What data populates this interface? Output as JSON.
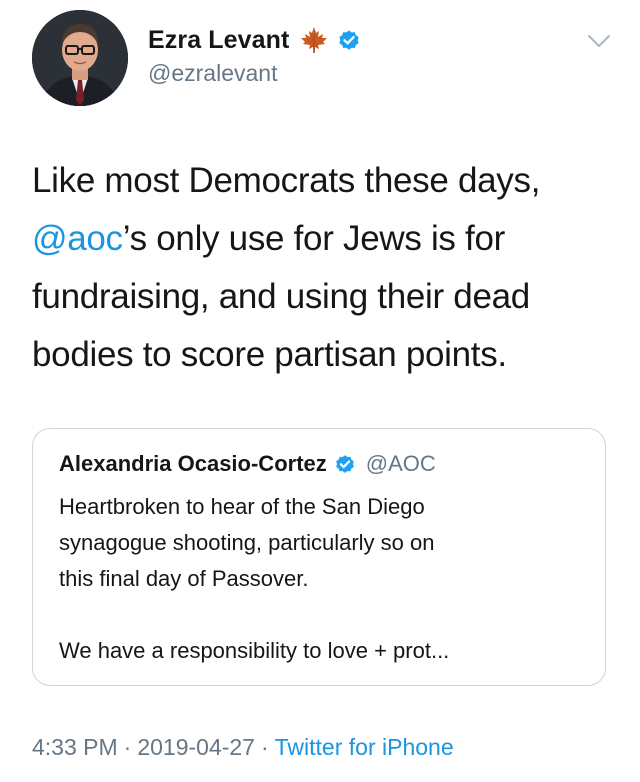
{
  "author": {
    "display_name": "Ezra Levant",
    "handle": "@ezralevant",
    "badge_icons": [
      "maple-leaf-icon",
      "verified-badge-icon"
    ],
    "menu_icon": "chevron-down-icon"
  },
  "tweet": {
    "line1": "Like most Democrats these days,",
    "mention": "@aoc",
    "line2_rest": "’s only use for Jews is for",
    "line3": "fundraising, and using their dead",
    "line4": "bodies to score partisan points."
  },
  "quote": {
    "display_name": "Alexandria Ocasio-Cortez",
    "handle": "@AOC",
    "badge_icon": "verified-badge-icon",
    "lines": [
      "Heartbroken to hear of the San Diego",
      "synagogue shooting, particularly so on",
      "this final day of Passover.",
      "We have a responsibility to love + prot..."
    ]
  },
  "footer": {
    "time": "4:33 PM",
    "separator": "·",
    "date": "2019-04-27",
    "source": "Twitter for iPhone"
  },
  "colors": {
    "link": "#1b95e0",
    "secondary_text": "#657786",
    "border": "#ccd6dd",
    "maple": "#c0521e",
    "verified": "#1da1f2"
  }
}
